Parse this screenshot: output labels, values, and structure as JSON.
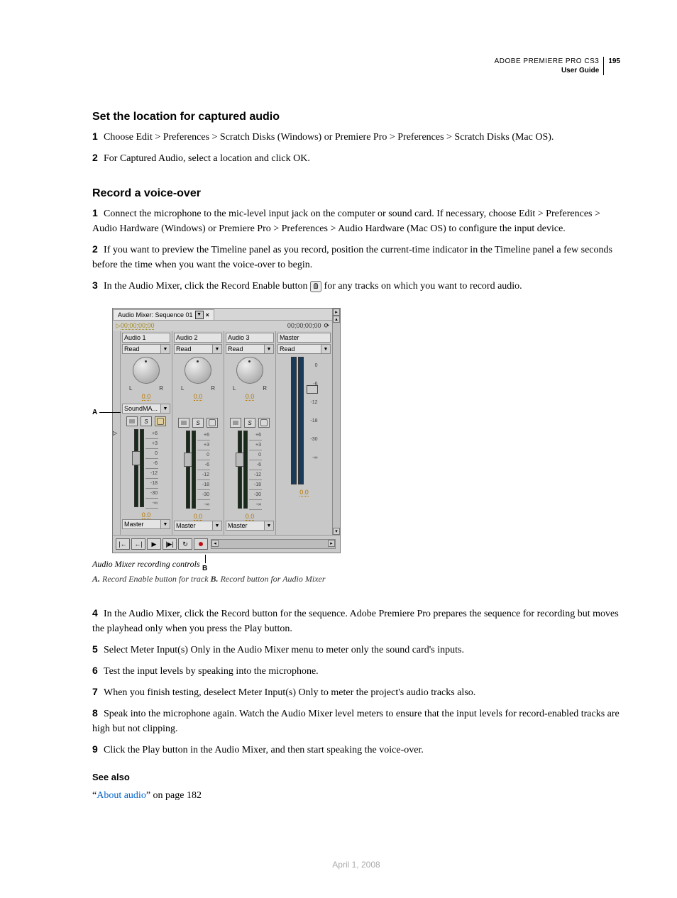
{
  "header": {
    "line1": "ADOBE PREMIERE PRO CS3",
    "line2": "User Guide",
    "page": "195"
  },
  "section1": {
    "title": "Set the location for captured audio",
    "steps": [
      {
        "n": "1",
        "t": "Choose Edit > Preferences > Scratch Disks (Windows) or Premiere Pro > Preferences > Scratch Disks (Mac OS)."
      },
      {
        "n": "2",
        "t": "For Captured Audio, select a location and click OK."
      }
    ]
  },
  "section2": {
    "title": "Record a voice-over",
    "steps_a": [
      {
        "n": "1",
        "t": "Connect the microphone to the mic-level input jack on the computer or sound card. If necessary, choose Edit > Preferences > Audio Hardware (Windows) or Premiere Pro > Preferences > Audio Hardware (Mac OS) to configure the input device."
      },
      {
        "n": "2",
        "t": "If you want to preview the Timeline panel as you record, position the current-time indicator in the Timeline panel a few seconds before the time when you want the voice-over to begin."
      }
    ],
    "step3_pre": "In the Audio Mixer, click the Record Enable button",
    "step3_post": " for any tracks on which you want to record audio.",
    "step3_n": "3",
    "steps_b": [
      {
        "n": "4",
        "t": "In the Audio Mixer, click the Record button for the sequence. Adobe Premiere Pro prepares the sequence for recording but moves the playhead only when you press the Play button."
      },
      {
        "n": "5",
        "t": "Select Meter Input(s) Only in the Audio Mixer menu to meter only the sound card's inputs."
      },
      {
        "n": "6",
        "t": "Test the input levels by speaking into the microphone."
      },
      {
        "n": "7",
        "t": "When you finish testing, deselect Meter Input(s) Only to meter the project's audio tracks also."
      },
      {
        "n": "8",
        "t": "Speak into the microphone again. Watch the Audio Mixer level meters to ensure that the input levels for record-enabled tracks are high but not clipping."
      },
      {
        "n": "9",
        "t": "Click the Play button in the Audio Mixer, and then start speaking the voice-over."
      }
    ]
  },
  "figure": {
    "tab_title": "Audio Mixer: Sequence 01",
    "tc1": "00;00;00;00",
    "tc2": "00;00;00;00",
    "tracks": [
      "Audio 1",
      "Audio 2",
      "Audio 3"
    ],
    "master": "Master",
    "mode": "Read",
    "soundfx": "SoundMA...",
    "pan": "0.0",
    "vol": "0.0",
    "out": "Master",
    "scale": [
      "+6",
      "+3",
      "0",
      "-6",
      "-12",
      "-18",
      "-30",
      "-∞"
    ],
    "master_scale": [
      "0",
      "-6",
      "-12",
      "-18",
      "-30",
      "-∞"
    ],
    "callout_a": "A",
    "callout_b": "B",
    "caption_title": "Audio Mixer recording controls",
    "caption_a_label": "A.",
    "caption_a_text": " Record Enable button for track  ",
    "caption_b_label": "B.",
    "caption_b_text": " Record button for Audio Mixer"
  },
  "seealso": {
    "title": "See also",
    "quote_open": "“",
    "link": "About audio",
    "quote_close": "” on page 182"
  },
  "footer_date": "April 1, 2008"
}
